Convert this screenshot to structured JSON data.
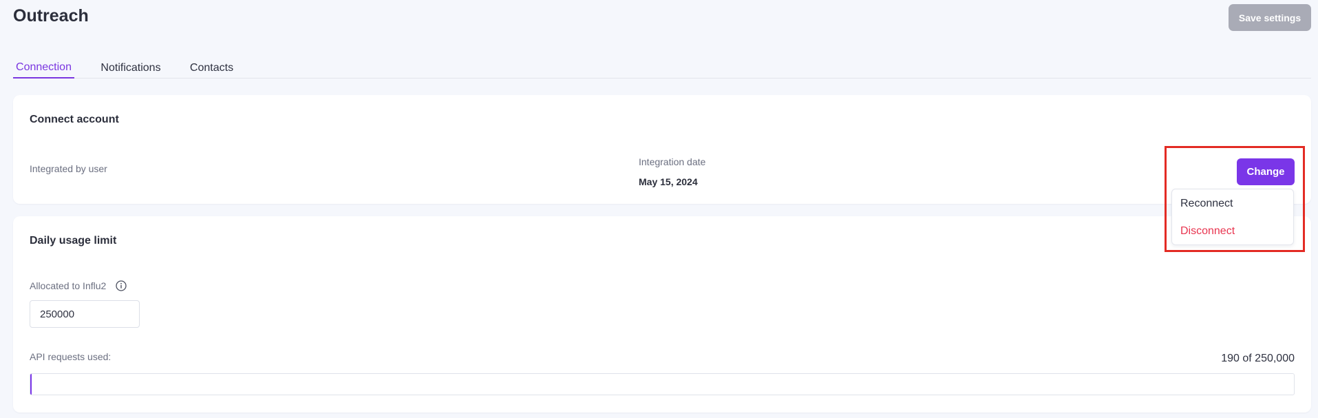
{
  "header": {
    "title": "Outreach",
    "save_label": "Save settings"
  },
  "tabs": [
    {
      "label": "Connection",
      "active": true
    },
    {
      "label": "Notifications",
      "active": false
    },
    {
      "label": "Contacts",
      "active": false
    }
  ],
  "connect_account": {
    "title": "Connect account",
    "integrated_by_label": "Integrated by user",
    "integration_date_label": "Integration date",
    "integration_date_value": "May 15, 2024",
    "change_label": "Change",
    "dropdown": {
      "reconnect_label": "Reconnect",
      "disconnect_label": "Disconnect"
    }
  },
  "daily_usage": {
    "title": "Daily usage limit",
    "allocated_label": "Allocated to Influ2",
    "allocated_value": "250000",
    "api_used_label": "API requests used:",
    "usage_text": "190 of 250,000",
    "used": 190,
    "limit": 250000
  },
  "colors": {
    "accent": "#7a36e8",
    "danger": "#e8344f",
    "highlight": "#e32b24",
    "disabled_button": "#a9abb6"
  },
  "icons": {
    "info": "info-circle-icon"
  }
}
